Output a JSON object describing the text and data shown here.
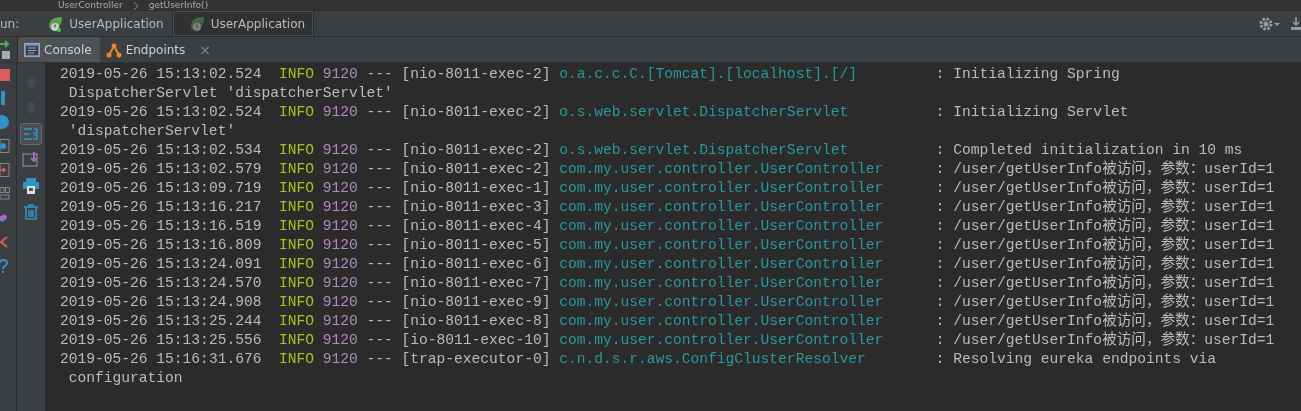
{
  "breadcrumb": [
    "UserController",
    "getUserInfo()"
  ],
  "run_bar": {
    "label": "un:",
    "tabs": [
      {
        "label": "UserApplication",
        "selected": false,
        "running": true
      },
      {
        "label": "UserApplication",
        "selected": true,
        "running": false
      }
    ]
  },
  "tool_tabs": [
    {
      "label": "Console",
      "selected": true,
      "closable": false,
      "kind": "console"
    },
    {
      "label": "Endpoints",
      "selected": false,
      "closable": true,
      "kind": "endpoints"
    }
  ],
  "close_glyph": "×",
  "toolbar": [
    {
      "kind": "up",
      "disabled": true,
      "selected": false
    },
    {
      "kind": "down",
      "disabled": true,
      "selected": false
    },
    {
      "kind": "wrap",
      "disabled": false,
      "selected": true
    },
    {
      "kind": "scroll",
      "disabled": false,
      "selected": false
    },
    {
      "kind": "print",
      "disabled": false,
      "selected": false
    },
    {
      "kind": "trash",
      "disabled": false,
      "selected": false
    }
  ],
  "log": [
    {
      "timestamp": "2019-05-26 15:13:02.524",
      "level": "INFO",
      "pid": "9120",
      "separator": "---",
      "thread": "[nio-8011-exec-2]",
      "logger": "o.a.c.c.C.[Tomcat].[localhost].[/]",
      "message": ": Initializing Spring",
      "continuation": "DispatcherServlet 'dispatcherServlet'"
    },
    {
      "timestamp": "2019-05-26 15:13:02.524",
      "level": "INFO",
      "pid": "9120",
      "separator": "---",
      "thread": "[nio-8011-exec-2]",
      "logger": "o.s.web.servlet.DispatcherServlet",
      "message": ": Initializing Servlet",
      "continuation": "'dispatcherServlet'"
    },
    {
      "timestamp": "2019-05-26 15:13:02.534",
      "level": "INFO",
      "pid": "9120",
      "separator": "---",
      "thread": "[nio-8011-exec-2]",
      "logger": "o.s.web.servlet.DispatcherServlet",
      "message": ": Completed initialization in 10 ms"
    },
    {
      "timestamp": "2019-05-26 15:13:02.579",
      "level": "INFO",
      "pid": "9120",
      "separator": "---",
      "thread": "[nio-8011-exec-2]",
      "logger": "com.my.user.controller.UserController",
      "message": ": /user/getUserInfo被访问，参数：userId=1"
    },
    {
      "timestamp": "2019-05-26 15:13:09.719",
      "level": "INFO",
      "pid": "9120",
      "separator": "---",
      "thread": "[nio-8011-exec-1]",
      "logger": "com.my.user.controller.UserController",
      "message": ": /user/getUserInfo被访问，参数：userId=1"
    },
    {
      "timestamp": "2019-05-26 15:13:16.217",
      "level": "INFO",
      "pid": "9120",
      "separator": "---",
      "thread": "[nio-8011-exec-3]",
      "logger": "com.my.user.controller.UserController",
      "message": ": /user/getUserInfo被访问，参数：userId=1"
    },
    {
      "timestamp": "2019-05-26 15:13:16.519",
      "level": "INFO",
      "pid": "9120",
      "separator": "---",
      "thread": "[nio-8011-exec-4]",
      "logger": "com.my.user.controller.UserController",
      "message": ": /user/getUserInfo被访问，参数：userId=1"
    },
    {
      "timestamp": "2019-05-26 15:13:16.809",
      "level": "INFO",
      "pid": "9120",
      "separator": "---",
      "thread": "[nio-8011-exec-5]",
      "logger": "com.my.user.controller.UserController",
      "message": ": /user/getUserInfo被访问，参数：userId=1"
    },
    {
      "timestamp": "2019-05-26 15:13:24.091",
      "level": "INFO",
      "pid": "9120",
      "separator": "---",
      "thread": "[nio-8011-exec-6]",
      "logger": "com.my.user.controller.UserController",
      "message": ": /user/getUserInfo被访问，参数：userId=1"
    },
    {
      "timestamp": "2019-05-26 15:13:24.570",
      "level": "INFO",
      "pid": "9120",
      "separator": "---",
      "thread": "[nio-8011-exec-7]",
      "logger": "com.my.user.controller.UserController",
      "message": ": /user/getUserInfo被访问，参数：userId=1"
    },
    {
      "timestamp": "2019-05-26 15:13:24.908",
      "level": "INFO",
      "pid": "9120",
      "separator": "---",
      "thread": "[nio-8011-exec-9]",
      "logger": "com.my.user.controller.UserController",
      "message": ": /user/getUserInfo被访问，参数：userId=1"
    },
    {
      "timestamp": "2019-05-26 15:13:25.244",
      "level": "INFO",
      "pid": "9120",
      "separator": "---",
      "thread": "[nio-8011-exec-8]",
      "logger": "com.my.user.controller.UserController",
      "message": ": /user/getUserInfo被访问，参数：userId=1"
    },
    {
      "timestamp": "2019-05-26 15:13:25.556",
      "level": "INFO",
      "pid": "9120",
      "separator": "---",
      "thread": "[io-8011-exec-10]",
      "logger": "com.my.user.controller.UserController",
      "message": ": /user/getUserInfo被访问，参数：userId=1"
    },
    {
      "timestamp": "2019-05-26 15:16:31.676",
      "level": "INFO",
      "pid": "9120",
      "separator": "---",
      "thread": "[trap-executor-0]",
      "logger": "c.n.d.s.r.aws.ConfigClusterResolver",
      "message": ": Resolving eureka endpoints via",
      "continuation": "configuration"
    }
  ]
}
